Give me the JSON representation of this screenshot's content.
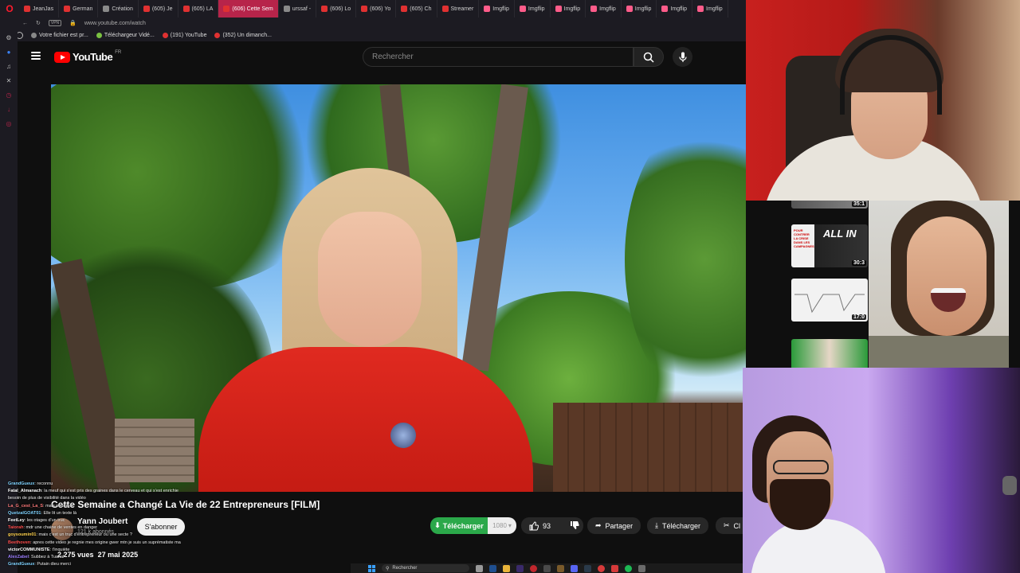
{
  "browser": {
    "tabs": [
      {
        "label": "JeanJas"
      },
      {
        "label": "German"
      },
      {
        "label": "Création"
      },
      {
        "label": "(605) Je"
      },
      {
        "label": "(605) LA"
      },
      {
        "label": "(606) Cette Sem"
      },
      {
        "label": "urssaf -"
      },
      {
        "label": "(606) Lo"
      },
      {
        "label": "(606) Yo"
      },
      {
        "label": "(605) Ch"
      },
      {
        "label": "Streamer"
      },
      {
        "label": "Imgflip"
      },
      {
        "label": "Imgflip"
      },
      {
        "label": "Imgflip"
      },
      {
        "label": "Imgflip"
      },
      {
        "label": "Imgflip"
      },
      {
        "label": "Imgflip"
      },
      {
        "label": "Imgflip"
      }
    ],
    "url": "www.youtube.com/watch",
    "bookmarks": [
      {
        "label": "Votre fichier est pr..."
      },
      {
        "label": "Téléchargeur Vidé..."
      },
      {
        "label": "(191) YouTube"
      },
      {
        "label": "(352) Un dimanch..."
      }
    ]
  },
  "youtube": {
    "logo_text": "YouTube",
    "country": "FR",
    "search_placeholder": "Rechercher",
    "video_title": "Cette Semaine a Changé La Vie de 22 Entrepreneurs [FILM]",
    "channel_name": "Yann Joubert",
    "subscribers": "121 k abonnés",
    "subscribe_label": "S'abonner",
    "download_green_label": "Télécharger",
    "quality": "1080",
    "likes": "93",
    "share_label": "Partager",
    "download_label": "Télécharger",
    "clip_label": "Cl",
    "views": "2 275 vues",
    "date": "27 mai 2025"
  },
  "chat": [
    {
      "user": "GrandGueux",
      "text": "reconnu",
      "color": "#7fd3ff"
    },
    {
      "user": "Fatal_Almanach",
      "text": "la meuf qui s'est pris des graines dans le cerveau et qui s'est enrichie",
      "color": "#ffffff"
    },
    {
      "user": "",
      "text": "besoin de plus de visibilité dans la vidéo",
      "color": "#ffffff"
    },
    {
      "user": "La_G_cest_La_S",
      "text": "mais pourquoi",
      "color": "#ff7a7a"
    },
    {
      "user": "QuetzalGOAT01",
      "text": "Elle lit un texte là",
      "color": "#7fd3ff"
    },
    {
      "user": "FeetLey",
      "text": "les otages d'un truc",
      "color": "#ffffff"
    },
    {
      "user": "Taiorah",
      "text": "mdr une chaine de ventes en danger",
      "color": "#ff4d4d"
    },
    {
      "user": "goysoumin01",
      "text": "mais c'est un truc d'entrepreneur ou une secte ?",
      "color": "#ffd24d"
    },
    {
      "user": "Beethoven",
      "text": "apres cette video je regnie mes origine gwer mtn je suis un suprématiste ma",
      "color": "#ff4d4d"
    },
    {
      "user": "victorCOMMUNISTE",
      "text": "t'inquiète",
      "color": "#ffffff"
    },
    {
      "user": "AlexZabel",
      "text": "Subbez à Tuahal",
      "color": "#9d7fff"
    },
    {
      "user": "GrandGueux",
      "text": "Putain dieu merci",
      "color": "#7fd3ff"
    }
  ],
  "taskbar": {
    "search_label": "Rechercher"
  },
  "sidebar_videos": [
    {
      "duration": "35:1"
    },
    {
      "duration": "30:3"
    },
    {
      "duration": "17:0"
    },
    {
      "duration": ""
    }
  ],
  "thumb_text": {
    "all_in": "ALL IN",
    "pour_contrer": "POUR CONTRER LA CRISE DANS LES CAMPAGNES"
  }
}
